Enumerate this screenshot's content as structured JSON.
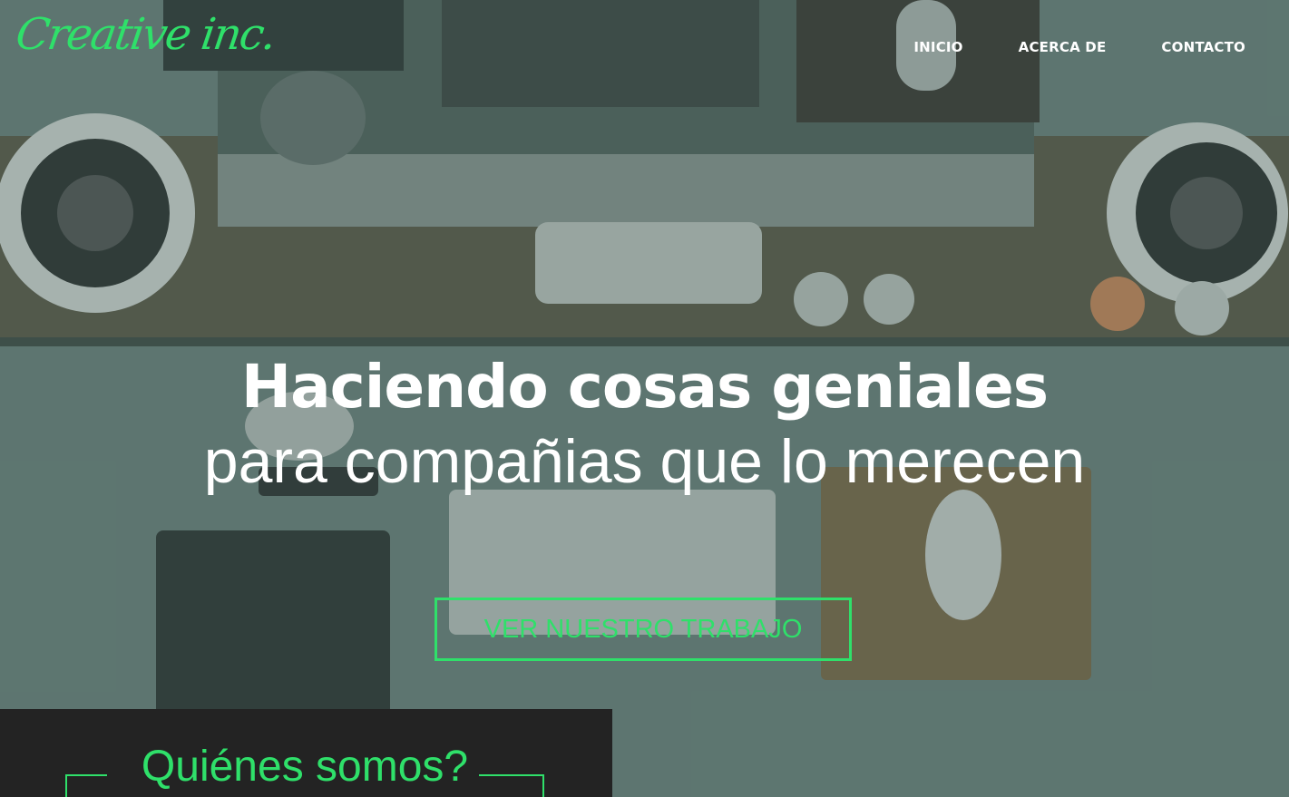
{
  "brand": {
    "logo_text": "Creative inc.",
    "accent_color": "#2fe06a"
  },
  "nav": {
    "items": [
      {
        "label": "INICIO"
      },
      {
        "label": "ACERCA DE"
      },
      {
        "label": "CONTACTO"
      }
    ]
  },
  "hero": {
    "headline": "Haciendo cosas geniales",
    "subline": "para compañias que lo merecen",
    "cta_label": "VER NUESTRO TRABAJO"
  },
  "about": {
    "title": "Quiénes somos?"
  }
}
